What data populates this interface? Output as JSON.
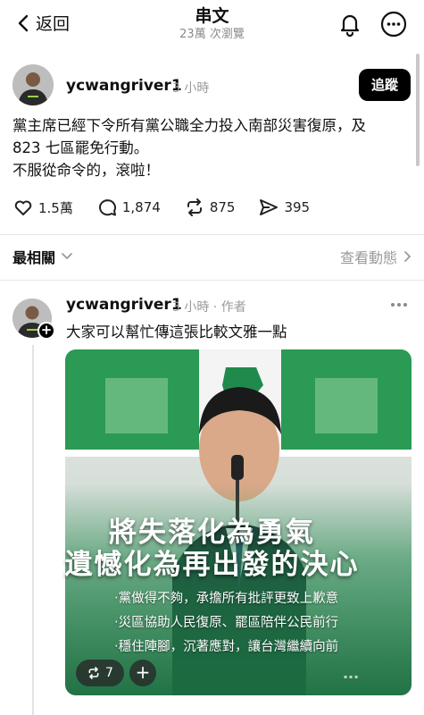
{
  "header": {
    "back_label": "返回",
    "title": "串文",
    "views": "23萬 次瀏覽"
  },
  "post": {
    "username": "ycwangriver1",
    "time": "3 小時",
    "follow_label": "追蹤",
    "text_line1": "黨主席已經下令所有黨公職全力投入南部災害復原，及",
    "text_line2": "823 七區罷免行動。",
    "text_line3": "不服從命令的，滾啦！",
    "likes": "1.5萬",
    "comments": "1,874",
    "reposts": "875",
    "shares": "395"
  },
  "sort": {
    "label": "最相關",
    "activity_label": "查看動態"
  },
  "reply": {
    "username": "ycwangriver1",
    "time_author": "3 小時 · 作者",
    "text": "大家可以幫忙傳這張比較文雅一點",
    "image": {
      "headline1": "將失落化為勇氣",
      "headline2": "遺憾化為再出發的決心",
      "bullet1": "‧黨做得不夠，承擔所有批評更致上歉意",
      "bullet2": "‧災區協助人民復原、罷區陪伴公民前行",
      "bullet3": "‧穩住陣腳，沉著應對，讓台灣繼續向前"
    },
    "repost_count": "7"
  },
  "colors": {
    "follow_bg": "#000000",
    "muted_text": "#9a9a9a",
    "party_green": "#1f8a4c"
  },
  "icons": [
    "chevron-left-icon",
    "bell-icon",
    "more-icon",
    "heart-icon",
    "comment-icon",
    "repost-icon",
    "share-icon",
    "chevron-down-icon",
    "chevron-right-icon",
    "plus-icon"
  ]
}
